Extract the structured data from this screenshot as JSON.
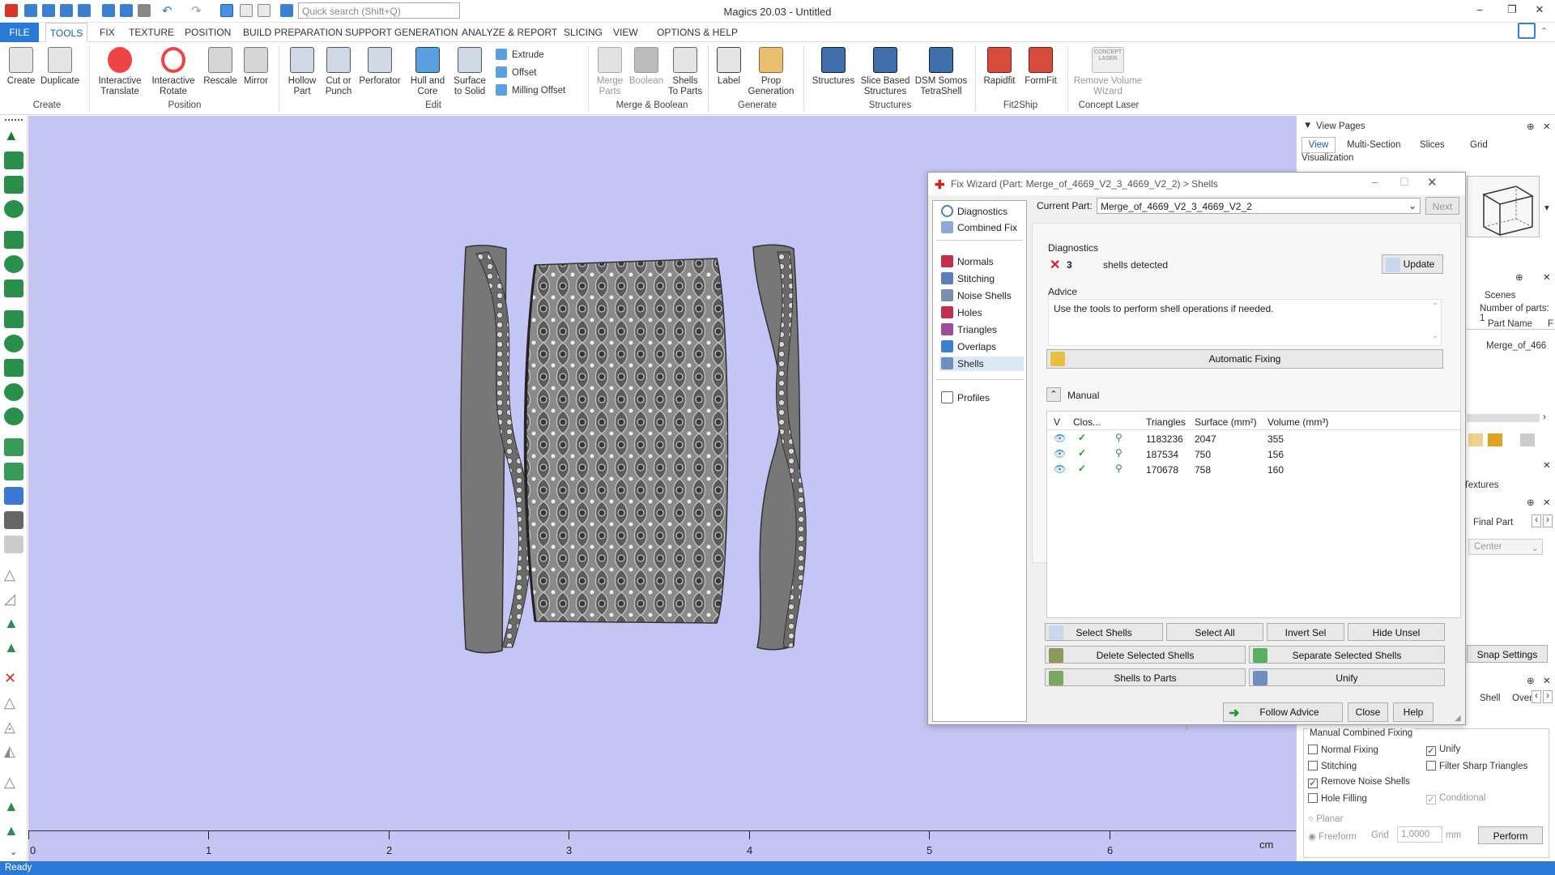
{
  "app": {
    "title": "Magics 20.03 - Untitled",
    "search_placeholder": "Quick search (Shift+Q)",
    "status": "Ready"
  },
  "menu": {
    "file": "FILE",
    "tools": "TOOLS",
    "items": [
      "FIX",
      "TEXTURE",
      "POSITION",
      "BUILD PREPARATION",
      "SUPPORT GENERATION",
      "ANALYZE & REPORT",
      "SLICING",
      "VIEW",
      "OPTIONS & HELP"
    ]
  },
  "ribbon": {
    "create": [
      "Create",
      "Duplicate"
    ],
    "position": [
      "Interactive\nTranslate",
      "Interactive\nRotate",
      "Rescale",
      "Mirror"
    ],
    "edit": [
      "Hollow\nPart",
      "Cut or\nPunch",
      "Perforator",
      "Hull and\nCore",
      "Surface\nto Solid"
    ],
    "edit_small": [
      "Extrude",
      "Offset",
      "Milling Offset"
    ],
    "merge": [
      "Merge\nParts",
      "Boolean",
      "Shells\nTo Parts"
    ],
    "generate": [
      "Label",
      "Prop\nGeneration"
    ],
    "structures": [
      "Structures",
      "Slice Based\nStructures",
      "DSM Somos\nTetraShell"
    ],
    "fit2ship": [
      "Rapidfit",
      "FormFit"
    ],
    "laser": [
      "Remove Volume\nWizard"
    ],
    "laser_badge": "CONCEPT\nLASER",
    "group_labels": [
      "Create",
      "Position",
      "Edit",
      "Merge & Boolean",
      "Generate",
      "Structures",
      "Fit2Ship",
      "Concept Laser"
    ]
  },
  "ruler": {
    "labels": [
      "0",
      "1",
      "2",
      "3",
      "4",
      "5",
      "6"
    ],
    "unit": "cm"
  },
  "dialog": {
    "title": "Fix Wizard (Part: Merge_of_4669_V2_3_4669_V2_2) > Shells",
    "nav_top": [
      "Diagnostics",
      "Combined Fix"
    ],
    "nav_items": [
      "Normals",
      "Stitching",
      "Noise Shells",
      "Holes",
      "Triangles",
      "Overlaps",
      "Shells"
    ],
    "nav_profiles": "Profiles",
    "current_part_label": "Current Part:",
    "current_part": "Merge_of_4669_V2_3_4669_V2_2",
    "next": "Next",
    "diagnostics_label": "Diagnostics",
    "diag_count": "3",
    "diag_text": "shells detected",
    "update": "Update",
    "advice_label": "Advice",
    "advice_text": "Use the tools to perform shell operations if needed.",
    "auto_fix": "Automatic Fixing",
    "manual_label": "Manual",
    "columns": [
      "V",
      "Clos...",
      "Triangles",
      "Surface (mm²)",
      "Volume (mm³)"
    ],
    "rows": [
      {
        "triangles": "1183236",
        "surface": "2047",
        "volume": "355"
      },
      {
        "triangles": "187534",
        "surface": "750",
        "volume": "156"
      },
      {
        "triangles": "170678",
        "surface": "758",
        "volume": "160"
      }
    ],
    "buttons": {
      "select_shells": "Select Shells",
      "select_all": "Select All",
      "invert_sel": "Invert Sel",
      "hide_unsel": "Hide Unsel",
      "delete_selected": "Delete Selected Shells",
      "separate_selected": "Separate Selected Shells",
      "shells_to_parts": "Shells to Parts",
      "unify": "Unify",
      "follow_advice": "Follow Advice",
      "close": "Close",
      "help": "Help"
    }
  },
  "right_panel": {
    "view_pages": "View Pages",
    "tabs": [
      "View",
      "Multi-Section",
      "Slices",
      "Grid"
    ],
    "visualization": "Visualization",
    "scenes": "Scenes",
    "num_parts": "Number of parts: 1",
    "part_name_col": "Part Name",
    "part_col_f": "F",
    "part_name": "Merge_of_466",
    "textures": "Textures",
    "final_part": "Final Part",
    "center": "Center",
    "snap_settings": "Snap Settings",
    "shell_tab": "Shell",
    "over_tab": "Over",
    "manual_combined": "Manual Combined Fixing",
    "options": [
      {
        "label": "Normal Fixing",
        "checked": false
      },
      {
        "label": "Unify",
        "checked": true
      },
      {
        "label": "Stitching",
        "checked": false
      },
      {
        "label": "Filter Sharp Triangles",
        "checked": false
      },
      {
        "label": "Remove Noise Shells",
        "checked": true
      },
      {
        "label": "Hole Filling",
        "checked": false
      },
      {
        "label": "Conditional",
        "checked": true
      }
    ],
    "planar": "Planar",
    "freeform": "Freeform",
    "grid_label": "Grid",
    "grid_value": "1,0000",
    "grid_unit": "mm",
    "perform": "Perform"
  },
  "colors": {
    "accent": "#2b79d6",
    "viewport": "#c5c5f5",
    "error": "#d62020",
    "ok": "#1a9c2a"
  }
}
